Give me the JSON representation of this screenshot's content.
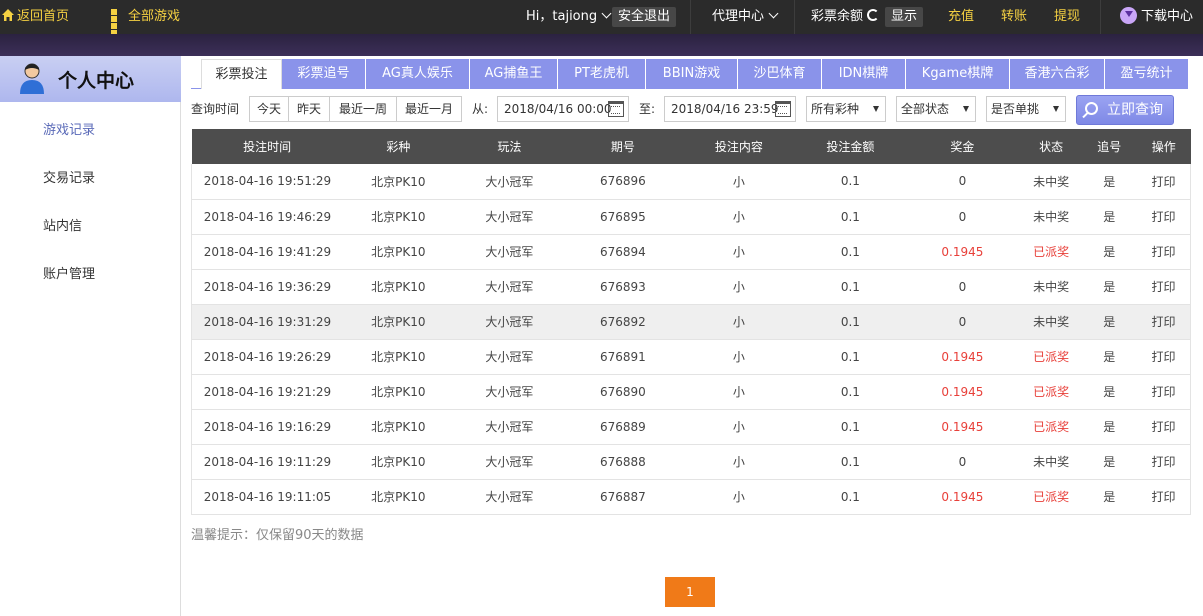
{
  "topbar": {
    "home_label": "返回首页",
    "all_games_label": "全部游戏",
    "greeting": "Hi，tajiong",
    "logout_label": "安全退出",
    "agent_center_label": "代理中心",
    "balance_label": "彩票余额",
    "show_label": "显示",
    "recharge_label": "充值",
    "transfer_label": "转账",
    "withdraw_label": "提现",
    "download_label": "下载中心"
  },
  "sidebar": {
    "title": "个人中心",
    "items": [
      {
        "label": "游戏记录",
        "active": true
      },
      {
        "label": "交易记录",
        "active": false
      },
      {
        "label": "站内信",
        "active": false
      },
      {
        "label": "账户管理",
        "active": false
      }
    ]
  },
  "tabs": [
    "彩票投注",
    "彩票追号",
    "AG真人娱乐",
    "AG捕鱼王",
    "PT老虎机",
    "BBIN游戏",
    "沙巴体育",
    "IDN棋牌",
    "Kgame棋牌",
    "香港六合彩",
    "盈亏统计"
  ],
  "filters": {
    "time_label": "查询时间",
    "quick": [
      "今天",
      "昨天",
      "最近一周",
      "最近一月"
    ],
    "from_label": "从:",
    "from_value": "2018/04/16 00:00",
    "to_label": "至:",
    "to_value": "2018/04/16 23:59",
    "lottery_select": "所有彩种",
    "status_select": "全部状态",
    "single_select": "是否单挑",
    "query_label": "立即查询"
  },
  "table": {
    "headers": [
      "投注时间",
      "彩种",
      "玩法",
      "期号",
      "投注内容",
      "投注金额",
      "奖金",
      "状态",
      "追号",
      "操作"
    ],
    "rows": [
      [
        "2018-04-16 19:51:29",
        "北京PK10",
        "大小冠军",
        "676896",
        "小",
        "0.1",
        "0",
        "未中奖",
        "是",
        "打印"
      ],
      [
        "2018-04-16 19:46:29",
        "北京PK10",
        "大小冠军",
        "676895",
        "小",
        "0.1",
        "0",
        "未中奖",
        "是",
        "打印"
      ],
      [
        "2018-04-16 19:41:29",
        "北京PK10",
        "大小冠军",
        "676894",
        "小",
        "0.1",
        "0.1945",
        "已派奖",
        "是",
        "打印"
      ],
      [
        "2018-04-16 19:36:29",
        "北京PK10",
        "大小冠军",
        "676893",
        "小",
        "0.1",
        "0",
        "未中奖",
        "是",
        "打印"
      ],
      [
        "2018-04-16 19:31:29",
        "北京PK10",
        "大小冠军",
        "676892",
        "小",
        "0.1",
        "0",
        "未中奖",
        "是",
        "打印"
      ],
      [
        "2018-04-16 19:26:29",
        "北京PK10",
        "大小冠军",
        "676891",
        "小",
        "0.1",
        "0.1945",
        "已派奖",
        "是",
        "打印"
      ],
      [
        "2018-04-16 19:21:29",
        "北京PK10",
        "大小冠军",
        "676890",
        "小",
        "0.1",
        "0.1945",
        "已派奖",
        "是",
        "打印"
      ],
      [
        "2018-04-16 19:16:29",
        "北京PK10",
        "大小冠军",
        "676889",
        "小",
        "0.1",
        "0.1945",
        "已派奖",
        "是",
        "打印"
      ],
      [
        "2018-04-16 19:11:29",
        "北京PK10",
        "大小冠军",
        "676888",
        "小",
        "0.1",
        "0",
        "未中奖",
        "是",
        "打印"
      ],
      [
        "2018-04-16 19:11:05",
        "北京PK10",
        "大小冠军",
        "676887",
        "小",
        "0.1",
        "0.1945",
        "已派奖",
        "是",
        "打印"
      ]
    ],
    "highlight_row": 4
  },
  "tip": "温馨提示：仅保留90天的数据",
  "pagination": {
    "current": "1"
  },
  "colors": {
    "accent": "#8a93ea",
    "win": "#e8403a",
    "page": "#f07a18",
    "topbar": "#2b2b2b"
  }
}
